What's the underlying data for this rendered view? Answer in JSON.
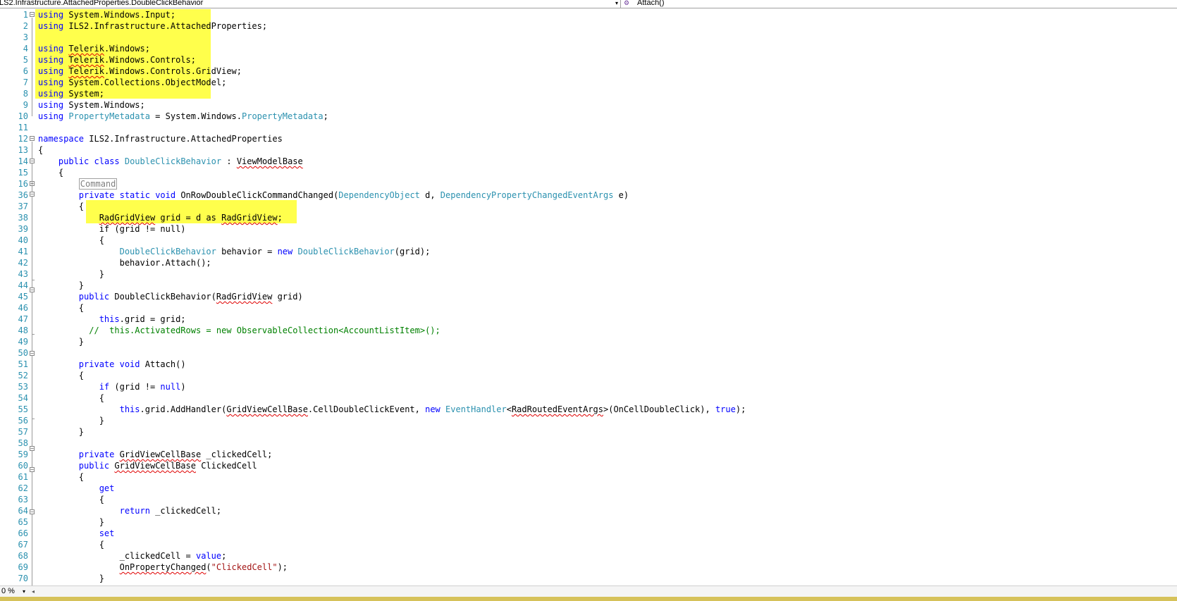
{
  "navbar": {
    "type_selector": "ILS2.Infrastructure.AttachedProperties.DoubleClickBehavior",
    "member_selector": "Attach()",
    "dropdown_glyph": "▾",
    "member_icon_glyph": "⚙"
  },
  "editor": {
    "line_numbers": [
      "1",
      "2",
      "3",
      "4",
      "5",
      "6",
      "7",
      "8",
      "9",
      "10",
      "11",
      "12",
      "13",
      "14",
      "15",
      "16",
      "36",
      "37",
      "38",
      "39",
      "40",
      "41",
      "42",
      "43",
      "44",
      "45",
      "46",
      "47",
      "48",
      "49",
      "50",
      "51",
      "52",
      "53",
      "54",
      "55",
      "56",
      "57",
      "58",
      "59",
      "60",
      "61",
      "62",
      "63",
      "64",
      "65",
      "66",
      "67",
      "68",
      "69",
      "70"
    ],
    "collapsed_region_label": "Command",
    "colors": {
      "keyword": "#0000ff",
      "type": "#2b91af",
      "comment": "#008000",
      "string": "#a31515",
      "highlight": "#ffff4c",
      "line_number": "#2b91af"
    }
  },
  "bottombar": {
    "zoom": "0 %",
    "zoom_dropdown_glyph": "▾",
    "scroll_left_glyph": "◂"
  }
}
